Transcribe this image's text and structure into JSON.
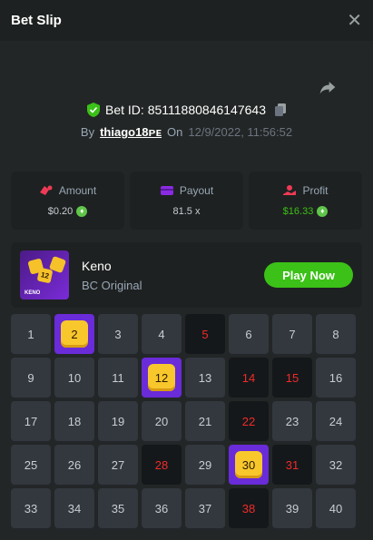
{
  "header": {
    "title": "Bet Slip",
    "close_icon": "close-icon"
  },
  "bet": {
    "id_text": "Bet ID: 85111880846147643",
    "by_label": "By",
    "user": "thiago18ᴘᴇ",
    "on_label": "On",
    "date": "12/9/2022, 11:56:52"
  },
  "stats": {
    "amount": {
      "label": "Amount",
      "value": "$0.20"
    },
    "payout": {
      "label": "Payout",
      "value": "81.5 x"
    },
    "profit": {
      "label": "Profit",
      "value": "$16.33"
    }
  },
  "game": {
    "name": "Keno",
    "provider": "BC Original",
    "play_label": "Play Now",
    "thumb_brand": "KENO",
    "thumb_dice": [
      "12",
      "",
      ""
    ]
  },
  "colors": {
    "accent_green": "#3bc117",
    "hit_purple": "#6a2bd9",
    "hit_gold": "#f8c72c",
    "miss_red": "#ef2b2b",
    "panel": "#1e2121",
    "bg": "#232626"
  },
  "keno": {
    "numbers": [
      "1",
      "2",
      "3",
      "4",
      "5",
      "6",
      "7",
      "8",
      "9",
      "10",
      "11",
      "12",
      "13",
      "14",
      "15",
      "16",
      "17",
      "18",
      "19",
      "20",
      "21",
      "22",
      "23",
      "24",
      "25",
      "26",
      "27",
      "28",
      "29",
      "30",
      "31",
      "32",
      "33",
      "34",
      "35",
      "36",
      "37",
      "38",
      "39",
      "40"
    ],
    "hits": [
      "2",
      "12",
      "30"
    ],
    "misses": [
      "5",
      "14",
      "15",
      "22",
      "28",
      "31",
      "38"
    ]
  }
}
